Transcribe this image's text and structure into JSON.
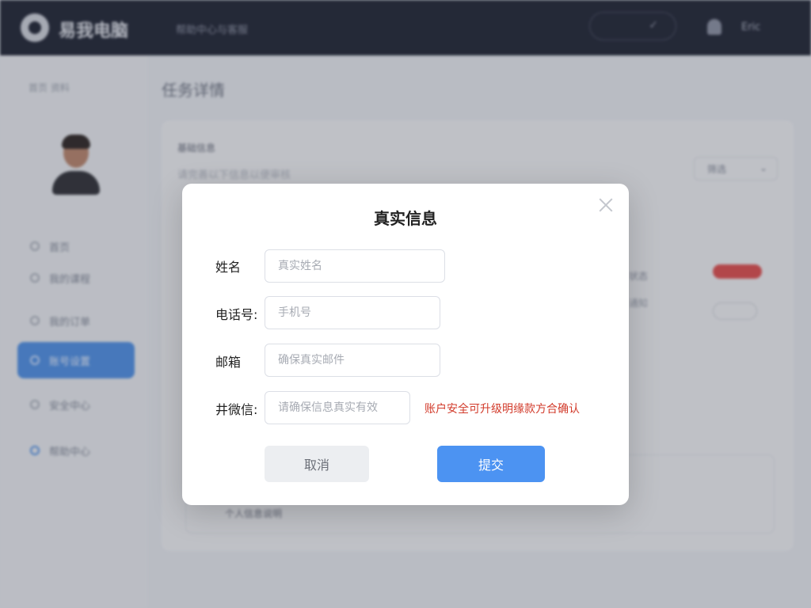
{
  "header": {
    "brand": "易我电脑",
    "nav_text": "帮助中心与客服",
    "user_name": "Eric",
    "pill_check": "✓"
  },
  "sidebar": {
    "crumb": "首页 资料",
    "items": [
      {
        "label": "首页"
      },
      {
        "label": "我的课程"
      },
      {
        "label": "我的订单"
      },
      {
        "label": "账号设置"
      },
      {
        "label": "安全中心"
      },
      {
        "label": "帮助中心"
      }
    ]
  },
  "main": {
    "page_title": "任务详情",
    "card_label": "基础信息",
    "card_sub": "请完善以下信息以便审核",
    "select_value": "筛选",
    "select_caret": "⌄",
    "line1": "状态",
    "line2": "通知",
    "inner_text": "个人信息说明"
  },
  "dialog": {
    "title": "真实信息",
    "fields": [
      {
        "label": "姓名",
        "placeholder": "真实姓名"
      },
      {
        "label": "电话号:",
        "placeholder": "手机号"
      },
      {
        "label": "邮箱",
        "placeholder": "确保真实邮件"
      },
      {
        "label": "井微信:",
        "placeholder": "请确保信息真实有效"
      }
    ],
    "error_text": "账户安全可升级明缘款方合确认",
    "cancel_label": "取消",
    "ok_label": "提交"
  }
}
